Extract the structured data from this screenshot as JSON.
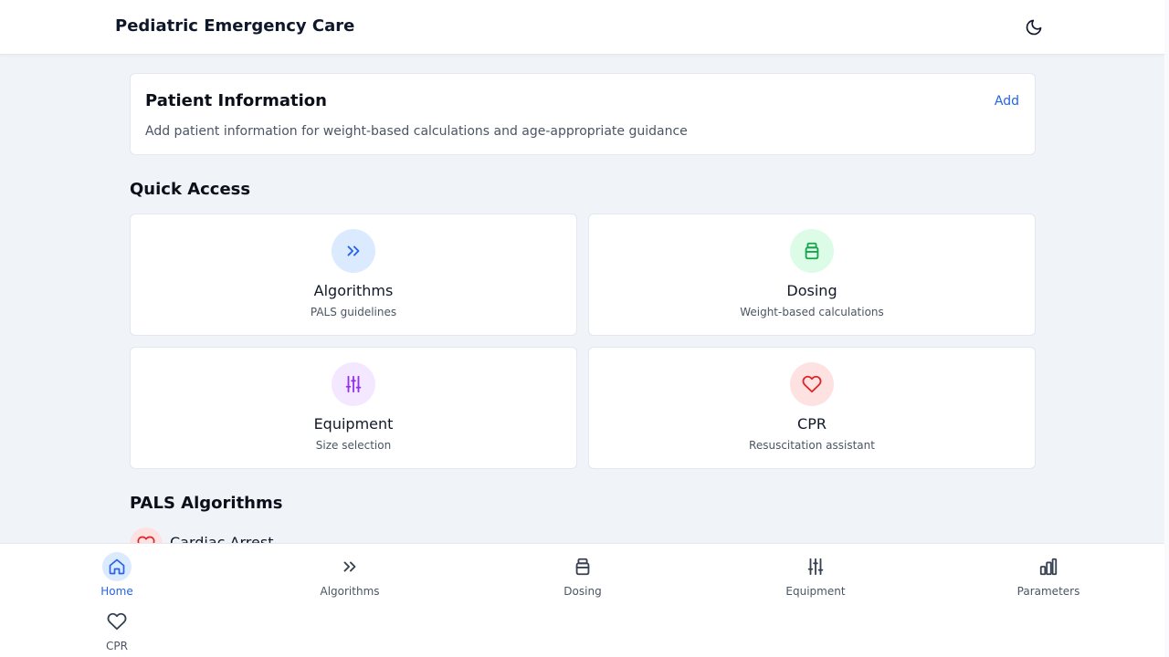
{
  "header": {
    "title": "Pediatric Emergency Care",
    "theme_icon": "moon-icon"
  },
  "patient": {
    "title": "Patient Information",
    "add_label": "Add",
    "description": "Add patient information for weight-based calculations and age-appropriate guidance"
  },
  "quick_access": {
    "title": "Quick Access",
    "cards": [
      {
        "label": "Algorithms",
        "subtitle": "PALS guidelines",
        "icon": "chevrons-right-icon",
        "color": "#2563eb",
        "bg": "#dbeafe"
      },
      {
        "label": "Dosing",
        "subtitle": "Weight-based calculations",
        "icon": "medicine-bottle-icon",
        "color": "#16a34a",
        "bg": "#dcfce7"
      },
      {
        "label": "Equipment",
        "subtitle": "Size selection",
        "icon": "sliders-icon",
        "color": "#9333ea",
        "bg": "#f3e8ff"
      },
      {
        "label": "CPR",
        "subtitle": "Resuscitation assistant",
        "icon": "heart-icon",
        "color": "#dc2626",
        "bg": "#fee2e2"
      }
    ]
  },
  "pals": {
    "title": "PALS Algorithms",
    "items": [
      {
        "label": "Cardiac Arrest",
        "icon": "heart-icon",
        "color": "#dc2626"
      }
    ]
  },
  "bottom_nav": {
    "active_color": "#2563eb",
    "items": [
      {
        "label": "Home",
        "icon": "home-icon",
        "active": true
      },
      {
        "label": "Algorithms",
        "icon": "chevrons-right-icon",
        "active": false
      },
      {
        "label": "Dosing",
        "icon": "medicine-bottle-icon",
        "active": false
      },
      {
        "label": "Equipment",
        "icon": "sliders-icon",
        "active": false
      },
      {
        "label": "Parameters",
        "icon": "bar-chart-icon",
        "active": false
      },
      {
        "label": "CPR",
        "icon": "heart-icon",
        "active": false
      }
    ]
  }
}
